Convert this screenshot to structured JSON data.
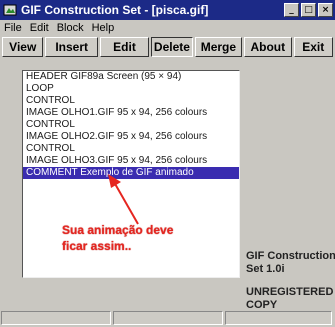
{
  "window": {
    "title": "GIF Construction Set - [pisca.gif]"
  },
  "menu": [
    {
      "label": "File"
    },
    {
      "label": "Edit"
    },
    {
      "label": "Block"
    },
    {
      "label": "Help"
    }
  ],
  "toolbar": [
    {
      "label": "View"
    },
    {
      "label": "Insert"
    },
    {
      "label": "Edit"
    },
    {
      "label": "Delete"
    },
    {
      "label": "Merge"
    },
    {
      "label": "About"
    },
    {
      "label": "Exit"
    }
  ],
  "blocks": [
    {
      "text": "HEADER GIF89a Screen (95 × 94)"
    },
    {
      "text": "LOOP"
    },
    {
      "text": "CONTROL"
    },
    {
      "text": "IMAGE OLHO1.GIF 95 x 94, 256 colours"
    },
    {
      "text": "CONTROL"
    },
    {
      "text": "IMAGE OLHO2.GIF 95 x 94, 256 colours"
    },
    {
      "text": "CONTROL"
    },
    {
      "text": "IMAGE OLHO3.GIF 95 x 94, 256 colours"
    },
    {
      "text": "COMMENT Exemplo de GIF animado",
      "selected": true
    }
  ],
  "annotation": {
    "line1": "Sua animação deve",
    "line2": "ficar assim..",
    "color": "#e52620"
  },
  "info": {
    "product_line1": "GIF Construction",
    "product_line2": "Set 1.0i",
    "license_line1": "UNREGISTERED",
    "license_line2": "COPY"
  },
  "colors": {
    "titlebar": "#1c2a87",
    "selection": "#3a2cb0"
  }
}
